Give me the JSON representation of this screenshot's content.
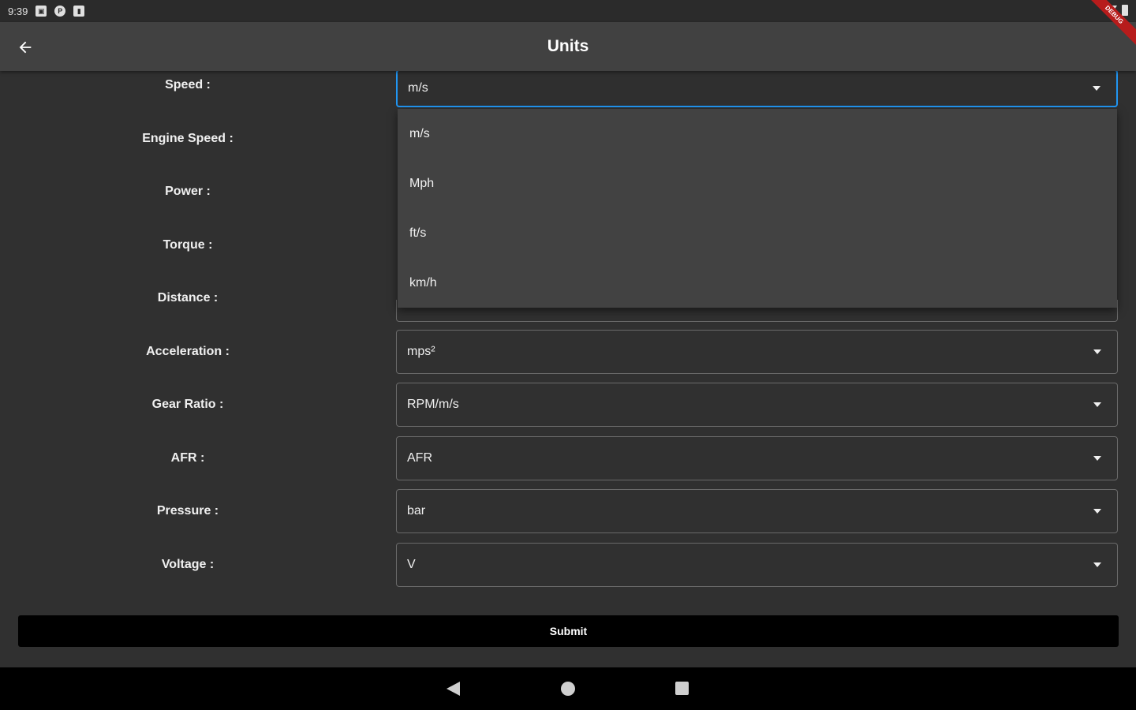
{
  "status_bar": {
    "time": "9:39"
  },
  "app_bar": {
    "title": "Units"
  },
  "debug_banner": "DEBUG",
  "fields": [
    {
      "key": "speed",
      "label": "Speed :",
      "value": "m/s"
    },
    {
      "key": "engine-speed",
      "label": "Engine Speed :",
      "value": ""
    },
    {
      "key": "power",
      "label": "Power :",
      "value": ""
    },
    {
      "key": "torque",
      "label": "Torque :",
      "value": ""
    },
    {
      "key": "distance",
      "label": "Distance :",
      "value": ""
    },
    {
      "key": "acceleration",
      "label": "Acceleration :",
      "value": "mps²"
    },
    {
      "key": "gear-ratio",
      "label": "Gear Ratio :",
      "value": "RPM/m/s"
    },
    {
      "key": "afr",
      "label": "AFR :",
      "value": "AFR"
    },
    {
      "key": "pressure",
      "label": "Pressure :",
      "value": "bar"
    },
    {
      "key": "voltage",
      "label": "Voltage :",
      "value": "V"
    }
  ],
  "speed_dropdown": {
    "options": [
      "m/s",
      "Mph",
      "ft/s",
      "km/h"
    ]
  },
  "submit_label": "Submit",
  "colors": {
    "background": "#303030",
    "app_bar": "#414141",
    "focus_border": "#2196f3",
    "submit": "#000000"
  }
}
